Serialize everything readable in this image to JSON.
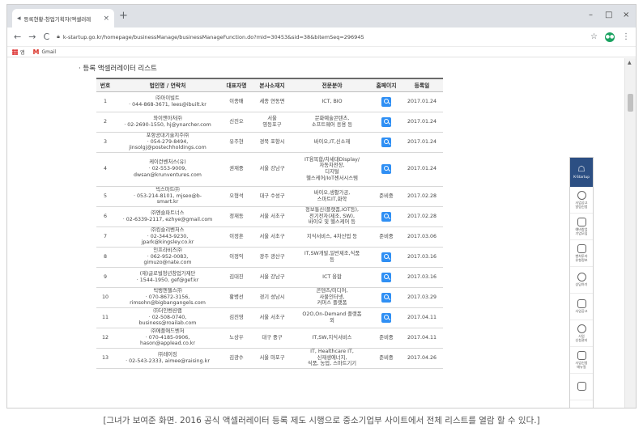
{
  "browser": {
    "tab_title": "등록현황-창업기획자(액셀러레",
    "tab_close": "×",
    "new_tab": "+",
    "url": "k-startup.go.kr/homepage/businessManage/businessManageFunction.do?mid=30453&sid=38&bitemSeq=296945",
    "bookmarks": [
      "앱",
      "Gmail"
    ],
    "profile_initial": "●●",
    "window_controls": [
      "–",
      "□",
      "×"
    ]
  },
  "page": {
    "heading": "· 등록 액셀러레이터 리스트",
    "columns": [
      "번호",
      "법인명 / 연락처",
      "대표자명",
      "본사소재지",
      "전문분야",
      "홈페이지",
      "등록일"
    ],
    "rows": [
      {
        "no": "1",
        "name": [
          "㈜아이빌트",
          "· 044-868-3671, lees@ibuilt.kr"
        ],
        "ceo": "이종배",
        "loc": [
          "세종 연동면"
        ],
        "field": [
          "ICT, BIO"
        ],
        "home": "icon",
        "date": "2017.01.24"
      },
      {
        "no": "2",
        "name": [
          "와이앤아처㈜",
          "· 02-2690-1550, hj@ynarcher.com"
        ],
        "ceo": "신진오",
        "loc": [
          "서울",
          "영등포구"
        ],
        "field": [
          "문화예술콘텐츠,",
          "소프트웨어 응용 등"
        ],
        "home": "icon",
        "date": "2017.01.24"
      },
      {
        "no": "3",
        "name": [
          "포항공대기술지주㈜",
          "· 054-279-8494,",
          "jinsolgj@postechholdings.com"
        ],
        "ceo": "유주현",
        "loc": [
          "경북 포항시"
        ],
        "field": [
          "바이오,IT,신소재"
        ],
        "home": "icon",
        "date": "2017.01.24"
      },
      {
        "no": "4",
        "name": [
          "케이런벤처스(유)",
          "· 02-553-9009,",
          "dwsan@krunventures.com"
        ],
        "ceo": "권재중",
        "loc": [
          "서울 강남구"
        ],
        "field": [
          "IT융복합/차세대Display/",
          "자동차전장,",
          "디지털",
          "헬스케어/IoT센서시스템"
        ],
        "home": "icon",
        "date": "2017.01.24"
      },
      {
        "no": "5",
        "name": [
          "빅스마트㈜",
          "· 053-214-8101, mjseo@b-",
          "smart.kr"
        ],
        "ceo": "오형석",
        "loc": [
          "대구 수성구"
        ],
        "field": [
          "바이오,생활가공,",
          "스마트IT,화학"
        ],
        "home": "준비중",
        "date": "2017.02.28"
      },
      {
        "no": "6",
        "name": [
          "㈜엔슬파트너스",
          "· 02-6339-2117, ezhye@gmail.com"
        ],
        "ceo": "정재동",
        "loc": [
          "서울 서초구"
        ],
        "field": [
          "정보통신(플랫폼,IOT등),",
          "전기전자(제조, SW),",
          "바이오 및 헬스케어 등"
        ],
        "home": "icon",
        "date": "2017.02.28"
      },
      {
        "no": "7",
        "name": [
          "㈜킹슬리벤처스",
          "· 02-3443-9230,",
          "jpark@kingsley.co.kr"
        ],
        "ceo": "이정훈",
        "loc": [
          "서울 서초구"
        ],
        "field": [
          "지식서비스, 4차산업 등"
        ],
        "home": "준비중",
        "date": "2017.03.06"
      },
      {
        "no": "8",
        "name": [
          "인프라비즈㈜",
          "· 062-952-0083,",
          "gimuzo@nate.com"
        ],
        "ceo": "이정익",
        "loc": [
          "광주 광산구"
        ],
        "field": [
          "IT,SW개발,일반제조,식품",
          "등"
        ],
        "home": "icon",
        "date": "2017.03.16"
      },
      {
        "no": "9",
        "name": [
          "(재)글로벌청년창업가재단",
          "· 1544-1950, gef@gef.kr"
        ],
        "ceo": "김대진",
        "loc": [
          "서울 강남구"
        ],
        "field": [
          "ICT 융합"
        ],
        "home": "icon",
        "date": "2017.03.16"
      },
      {
        "no": "10",
        "name": [
          "빅뱅엔젤스㈜",
          "· 070-8672-3156,",
          "rimsohn@bigbangangels.com"
        ],
        "ceo": "황병선",
        "loc": [
          "경기 성남시"
        ],
        "field": [
          "콘텐츠/미디어,",
          "사물인터넷,",
          "커머스 플랫폼"
        ],
        "home": "icon",
        "date": "2017.03.29"
      },
      {
        "no": "11",
        "name": [
          "㈜더인벤션랩",
          "· 02-508-0740,",
          "business@roailab.com"
        ],
        "ceo": "김진영",
        "loc": [
          "서울 서초구"
        ],
        "field": [
          "O2O,On-Demand 플랫폼",
          "외"
        ],
        "home": "icon",
        "date": "2017.04.11"
      },
      {
        "no": "12",
        "name": [
          "㈜에플애드벤처",
          "· 070-4185-0906,",
          "hason@applead.co.kr"
        ],
        "ceo": "노상우",
        "loc": [
          "대구 중구"
        ],
        "field": [
          "IT,SW,지식서비스"
        ],
        "home": "준비중",
        "date": "2017.04.11"
      },
      {
        "no": "13",
        "name": [
          "㈜레이징",
          "· 02-543-2333, aimee@raising.kr"
        ],
        "ceo": "김광수",
        "loc": [
          "서울 마포구"
        ],
        "field": [
          "IT, Healthcare IT,",
          "신재생에너지,",
          "식품, 농업, 스마트기기"
        ],
        "home": "준비중",
        "date": "2017.04.26"
      }
    ]
  },
  "sidebar": {
    "top_label": "K-Startup",
    "items": [
      {
        "label": "사업공고\n알림신청",
        "icon": "bulb-icon"
      },
      {
        "label": "예비창업\n기업모집",
        "icon": "document-icon"
      },
      {
        "label": "벤처투자\n유형정보",
        "icon": "bell-icon"
      },
      {
        "label": "상담하기",
        "icon": "headset-icon"
      },
      {
        "label": "사업공고",
        "icon": "megaphone-icon"
      },
      {
        "label": "사업\n신청관리",
        "icon": "gear-icon"
      },
      {
        "label": "사업신청\n매뉴얼",
        "icon": "calendar-icon"
      },
      {
        "label": "",
        "icon": "question-icon"
      }
    ]
  },
  "caption": "[그녀가 보여준 화면. 2016 공식 액셀러레이터 등록 제도 시행으로 중소기업부 사이트에서 전체 리스트를 열람 할 수 있다.]"
}
